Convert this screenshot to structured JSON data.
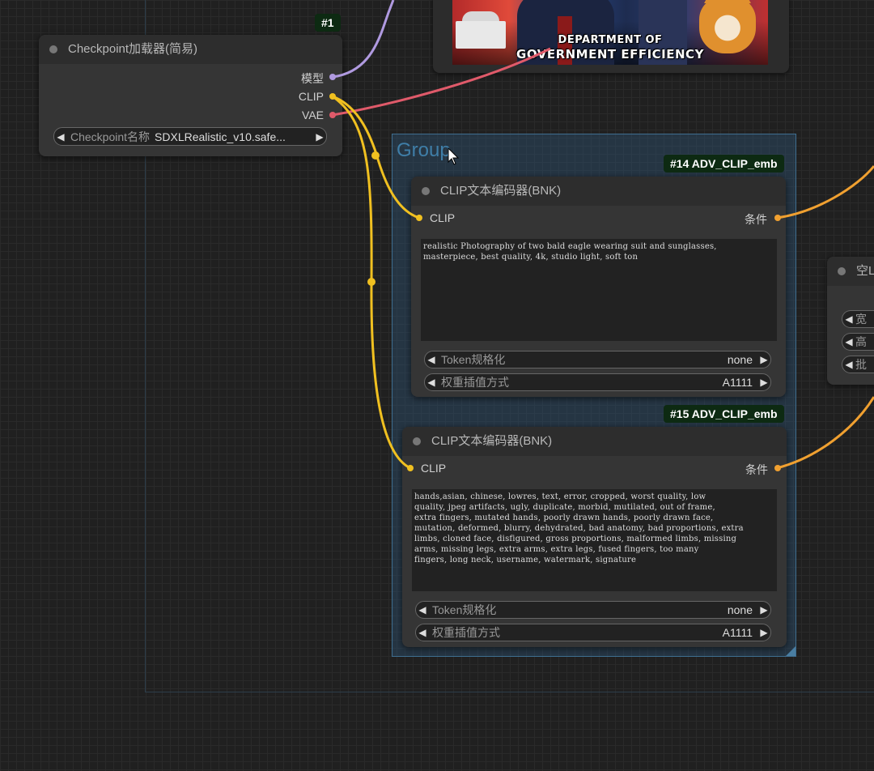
{
  "outer_group": {},
  "image_node": {
    "poster_line1": "DEPARTMENT OF",
    "poster_line2": "GOVERNMENT EFFICIENCY"
  },
  "checkpoint_node": {
    "badge": "#1",
    "title": "Checkpoint加载器(简易)",
    "outputs": [
      "模型",
      "CLIP",
      "VAE"
    ],
    "ckpt_label": "Checkpoint名称",
    "ckpt_value": "SDXLRealistic_v10.safe..."
  },
  "group": {
    "title": "Group"
  },
  "clip_node_1": {
    "badge": "#14 ADV_CLIP_emb",
    "title": "CLIP文本编码器(BNK)",
    "input": "CLIP",
    "output": "条件",
    "text": "realistic Photography of two bald eagle wearing suit and sunglasses,\nmasterpiece, best quality, 4k, studio light, soft ton",
    "token_label": "Token规格化",
    "token_value": "none",
    "weight_label": "权重插值方式",
    "weight_value": "A1111"
  },
  "clip_node_2": {
    "badge": "#15 ADV_CLIP_emb",
    "title": "CLIP文本编码器(BNK)",
    "input": "CLIP",
    "output": "条件",
    "text": "hands,asian, chinese, lowres, text, error, cropped, worst quality, low\nquality, jpeg artifacts, ugly, duplicate, morbid, mutilated, out of frame,\nextra fingers, mutated hands, poorly drawn hands, poorly drawn face,\nmutation, deformed, blurry, dehydrated, bad anatomy, bad proportions, extra\nlimbs, cloned face, disfigured, gross proportions, malformed limbs, missing\narms, missing legs, extra arms, extra legs, fused fingers, too many\nfingers, long neck, username, watermark, signature",
    "token_label": "Token规格化",
    "token_value": "none",
    "weight_label": "权重插值方式",
    "weight_value": "A1111"
  },
  "latent_node": {
    "title": "空L",
    "widgets": [
      "宽",
      "高",
      "批"
    ]
  },
  "colors": {
    "clip_wire": "#f0c020",
    "vae_wire": "#e05a6a",
    "model_wire": "#b09ae0",
    "cond_wire": "#f0a030",
    "badge_bg": "#0d2a12"
  },
  "icons": [
    "arrow-left-icon",
    "arrow-right-icon",
    "cursor-icon"
  ]
}
